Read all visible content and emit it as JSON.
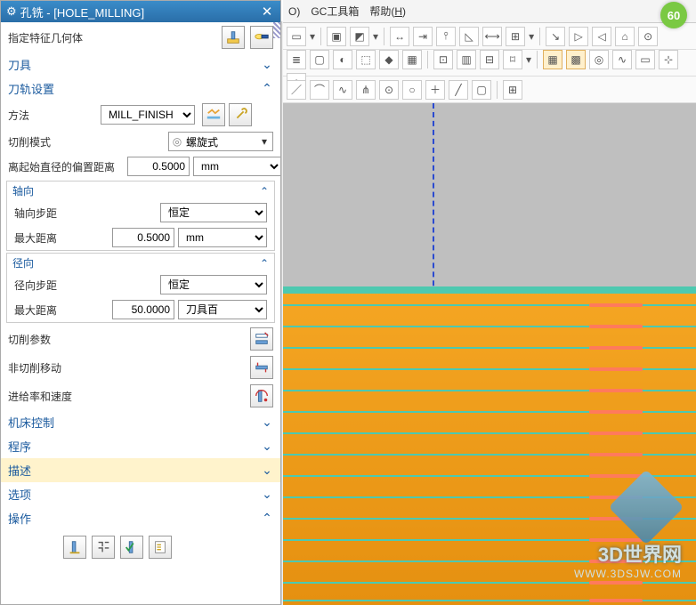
{
  "dialog": {
    "title": "孔铣 - [HOLE_MILLING]",
    "geomSpec": {
      "label": "指定特征几何体"
    },
    "sections": {
      "tools": "刀具",
      "toolpath": "刀轨设置",
      "machine": "机床控制",
      "program": "程序",
      "description": "描述",
      "options": "选项",
      "operations": "操作"
    },
    "method": {
      "label": "方法",
      "value": "MILL_FINISH"
    },
    "cutMode": {
      "label": "切削模式",
      "value": "螺旋式"
    },
    "offsetFromStart": {
      "label": "离起始直径的偏置距离",
      "value": "0.5000",
      "unit": "mm"
    },
    "axial": {
      "title": "轴向",
      "step": {
        "label": "轴向步距",
        "value": "恒定"
      },
      "max": {
        "label": "最大距离",
        "value": "0.5000",
        "unit": "mm"
      }
    },
    "radial": {
      "title": "径向",
      "step": {
        "label": "径向步距",
        "value": "恒定"
      },
      "max": {
        "label": "最大距离",
        "value": "50.0000",
        "unit": "刀具百"
      }
    },
    "cutParams": "切削参数",
    "nonCut": "非切削移动",
    "feedSpeed": "进给率和速度"
  },
  "menubar": {
    "item1": "O)",
    "item2": "GC工具箱",
    "item3_pre": "帮助(",
    "item3_u": "H",
    "item3_post": ")"
  },
  "badge": "60",
  "watermark": {
    "t1": "3D世界网",
    "t2": "WWW.3DSJW.COM"
  }
}
